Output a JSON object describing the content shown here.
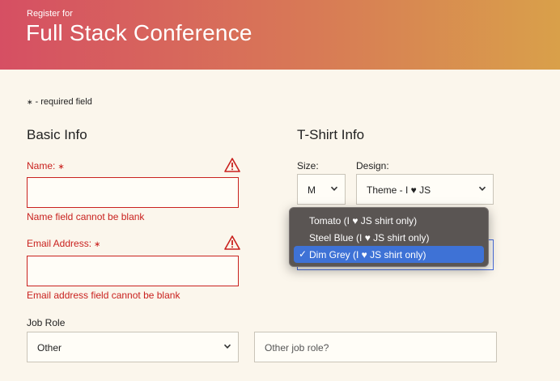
{
  "header": {
    "subtitle": "Register for",
    "title": "Full Stack Conference"
  },
  "required_note": {
    "star": "∗",
    "text": "- required field"
  },
  "basic_info": {
    "title": "Basic Info",
    "name": {
      "label": "Name:",
      "star": "∗",
      "value": "",
      "error": "Name field cannot be blank"
    },
    "email": {
      "label": "Email Address:",
      "star": "∗",
      "value": "",
      "error": "Email address field cannot be blank"
    },
    "job_role": {
      "label": "Job Role",
      "selected": "Other",
      "other_placeholder": "Other job role?"
    }
  },
  "tshirt_info": {
    "title": "T-Shirt Info",
    "size": {
      "label": "Size:",
      "selected": "M"
    },
    "design": {
      "label": "Design:",
      "selected": "Theme - I ♥ JS",
      "options": [
        {
          "label": "Tomato (I ♥ JS shirt only)",
          "selected": false
        },
        {
          "label": "Steel Blue (I ♥ JS shirt only)",
          "selected": false
        },
        {
          "label": "Dim Grey (I ♥ JS shirt only)",
          "selected": true
        }
      ]
    }
  },
  "colors": {
    "error": "#c9211e",
    "accent": "#3e72d6",
    "header_start": "#d64f63",
    "header_end": "#d9a04a"
  }
}
